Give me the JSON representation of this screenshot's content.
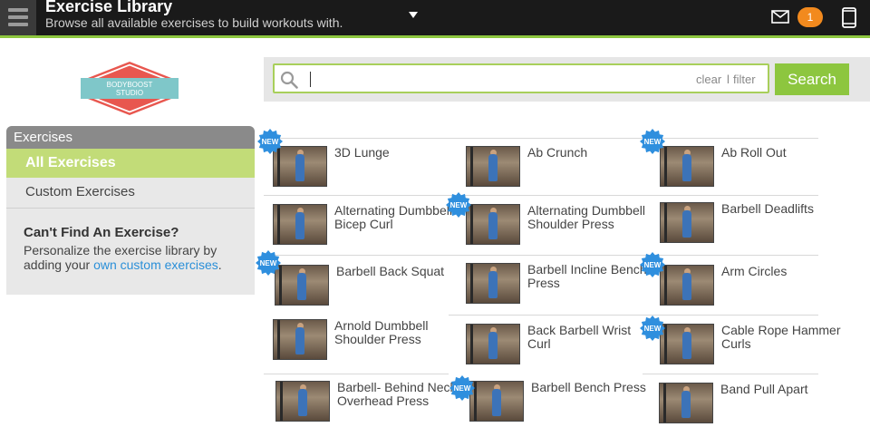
{
  "header": {
    "title": "Exercise Library",
    "subtitle": "Browse all available exercises to build workouts with.",
    "notification_count": "1"
  },
  "logo": {
    "line1": "BODYBOOST",
    "line2": "STUDIO"
  },
  "sidebar": {
    "header": "Exercises",
    "items": [
      {
        "label": "All Exercises",
        "active": true
      },
      {
        "label": "Custom Exercises",
        "active": false
      }
    ],
    "help_title": "Can't Find An Exercise?",
    "help_text": "Personalize the exercise library by adding your ",
    "help_link": "own custom exercises",
    "help_end": "."
  },
  "search": {
    "value": "",
    "clear_label": "clear",
    "separator": "l",
    "filter_label": "filter",
    "button_label": "Search"
  },
  "new_badge_label": "NEW",
  "exercises": [
    {
      "name": "3D Lunge",
      "is_new": true
    },
    {
      "name": "Ab Crunch",
      "is_new": false
    },
    {
      "name": "Ab Roll Out",
      "is_new": true
    },
    {
      "name": "Alternating Dumbbell Bicep Curl",
      "is_new": false
    },
    {
      "name": "Alternating Dumbbell Shoulder Press",
      "is_new": true
    },
    {
      "name": "Barbell Deadlifts",
      "is_new": false
    },
    {
      "name": "Barbell Back Squat",
      "is_new": true
    },
    {
      "name": "Barbell Incline Bench Press",
      "is_new": false
    },
    {
      "name": "Arm Circles",
      "is_new": true
    },
    {
      "name": "Arnold Dumbbell Shoulder Press",
      "is_new": false
    },
    {
      "name": "Back Barbell Wrist Curl",
      "is_new": false
    },
    {
      "name": "Cable Rope Hammer Curls",
      "is_new": true
    },
    {
      "name": "Barbell- Behind Neck Overhead Press",
      "is_new": false
    },
    {
      "name": "Barbell Bench Press",
      "is_new": true
    },
    {
      "name": "Band Pull Apart",
      "is_new": false
    }
  ],
  "colors": {
    "accent_green": "#8dc63f",
    "active_item": "#c2dc78",
    "badge_orange": "#f28a1e",
    "new_badge_blue": "#2f8fde",
    "link_blue": "#2a8fd8",
    "logo_red": "#e8574f",
    "logo_teal": "#7fc7c9"
  }
}
